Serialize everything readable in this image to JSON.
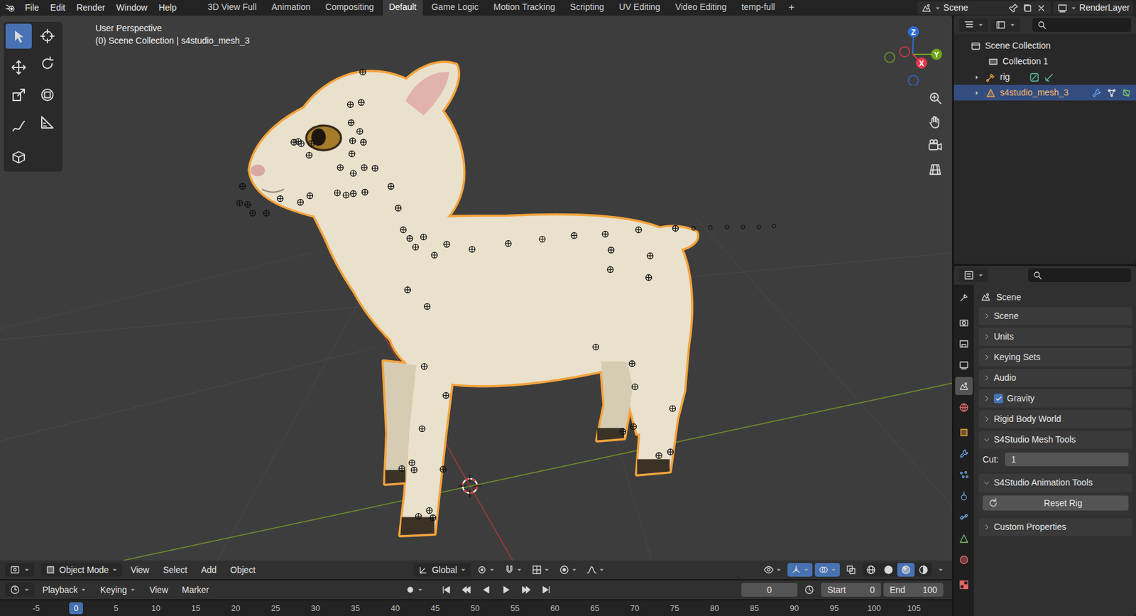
{
  "menu": [
    "File",
    "Edit",
    "Render",
    "Window",
    "Help"
  ],
  "workspaces": [
    {
      "label": "3D View Full",
      "selected": false
    },
    {
      "label": "Animation",
      "selected": false
    },
    {
      "label": "Compositing",
      "selected": false
    },
    {
      "label": "Default",
      "selected": true
    },
    {
      "label": "Game Logic",
      "selected": false
    },
    {
      "label": "Motion Tracking",
      "selected": false
    },
    {
      "label": "Scripting",
      "selected": false
    },
    {
      "label": "UV Editing",
      "selected": false
    },
    {
      "label": "Video Editing",
      "selected": false
    },
    {
      "label": "temp-full",
      "selected": false
    }
  ],
  "add_workspace": "+",
  "scene": {
    "label": "Scene"
  },
  "view_layer": {
    "label": "RenderLayer"
  },
  "viewport": {
    "title": "User Perspective",
    "context": "(0) Scene Collection | s4studio_mesh_3",
    "axes": [
      {
        "label": "Z",
        "color": "#2f6fd6"
      },
      {
        "label": "Y",
        "color": "#6ea51c"
      },
      {
        "label": "X",
        "color": "#e8384e"
      }
    ],
    "tools": [
      {
        "kind": "select-box",
        "selected": true
      },
      {
        "kind": "cursor",
        "selected": false
      },
      {
        "kind": "move",
        "selected": false
      },
      {
        "kind": "rotate",
        "selected": false
      },
      {
        "kind": "scale",
        "selected": false
      },
      {
        "kind": "transform",
        "selected": false
      },
      {
        "kind": "annotate",
        "selected": false
      },
      {
        "kind": "measure",
        "selected": false
      },
      {
        "kind": "add-cube",
        "selected": false
      }
    ],
    "nav": [
      {
        "kind": "zoom"
      },
      {
        "kind": "pan"
      },
      {
        "kind": "camera"
      },
      {
        "kind": "ortho"
      }
    ]
  },
  "viewport_header": {
    "mode": "Object Mode",
    "menus": [
      "View",
      "Select",
      "Add",
      "Object"
    ],
    "orientation": "Global",
    "toggles": [
      {
        "kind": "gizmos",
        "on": true
      },
      {
        "kind": "overlays",
        "on": true
      },
      {
        "kind": "xray",
        "on": false
      }
    ],
    "shading": [
      {
        "kind": "wireframe",
        "selected": false
      },
      {
        "kind": "solid",
        "selected": false
      },
      {
        "kind": "material-shade",
        "selected": true
      },
      {
        "kind": "rendered",
        "selected": false
      }
    ]
  },
  "timeline": {
    "menus": [
      "Playback",
      "Keying",
      "View",
      "Marker"
    ],
    "controls": [
      {
        "kind": "record"
      },
      {
        "kind": "jump-start"
      },
      {
        "kind": "prev-key"
      },
      {
        "kind": "play-reverse"
      },
      {
        "kind": "play"
      },
      {
        "kind": "next-key"
      },
      {
        "kind": "jump-end"
      }
    ],
    "current_frame": "0",
    "start_label": "Start",
    "start": "0",
    "end_label": "End",
    "end": "100",
    "ticks": [
      {
        "label": "-5",
        "selected": false
      },
      {
        "label": "0",
        "selected": true
      },
      {
        "label": "5",
        "selected": false
      },
      {
        "label": "10",
        "selected": false
      },
      {
        "label": "15",
        "selected": false
      },
      {
        "label": "20",
        "selected": false
      },
      {
        "label": "25",
        "selected": false
      },
      {
        "label": "30",
        "selected": false
      },
      {
        "label": "35",
        "selected": false
      },
      {
        "label": "40",
        "selected": false
      },
      {
        "label": "45",
        "selected": false
      },
      {
        "label": "50",
        "selected": false
      },
      {
        "label": "55",
        "selected": false
      },
      {
        "label": "60",
        "selected": false
      },
      {
        "label": "65",
        "selected": false
      },
      {
        "label": "70",
        "selected": false
      },
      {
        "label": "75",
        "selected": false
      },
      {
        "label": "80",
        "selected": false
      },
      {
        "label": "85",
        "selected": false
      },
      {
        "label": "90",
        "selected": false
      },
      {
        "label": "95",
        "selected": false
      },
      {
        "label": "100",
        "selected": false
      },
      {
        "label": "105",
        "selected": false
      }
    ]
  },
  "outliner": {
    "items": [
      {
        "label": "Scene Collection",
        "kind": "scene-collection",
        "selected": false
      },
      {
        "label": "Collection 1",
        "kind": "collection",
        "selected": false
      },
      {
        "label": "rig",
        "kind": "armature",
        "selected": false,
        "expanded": false
      },
      {
        "label": "s4studio_mesh_3",
        "kind": "mesh",
        "selected": true,
        "expanded": false
      }
    ]
  },
  "properties": {
    "title": "Scene",
    "tabs": [
      {
        "kind": "tool",
        "selected": false
      },
      {
        "kind": "render",
        "selected": false
      },
      {
        "kind": "output",
        "selected": false
      },
      {
        "kind": "view-layer",
        "selected": false
      },
      {
        "kind": "scene",
        "selected": true
      },
      {
        "kind": "world",
        "selected": false
      },
      {
        "kind": "object",
        "selected": false
      },
      {
        "kind": "modifiers",
        "selected": false
      },
      {
        "kind": "particles",
        "selected": false
      },
      {
        "kind": "physics",
        "selected": false
      },
      {
        "kind": "constraints",
        "selected": false
      },
      {
        "kind": "data",
        "selected": false
      },
      {
        "kind": "material",
        "selected": false
      },
      {
        "kind": "texture",
        "selected": false
      }
    ],
    "panels": [
      {
        "label": "Scene",
        "kind": "plain",
        "expanded": false
      },
      {
        "label": "Units",
        "kind": "plain",
        "expanded": false
      },
      {
        "label": "Keying Sets",
        "kind": "plain",
        "expanded": false
      },
      {
        "label": "Audio",
        "kind": "plain",
        "expanded": false
      },
      {
        "label": "Gravity",
        "kind": "checkbox",
        "expanded": false,
        "checked": true
      },
      {
        "label": "Rigid Body World",
        "kind": "plain",
        "expanded": false
      },
      {
        "label": "S4Studio Mesh Tools",
        "kind": "field",
        "expanded": true,
        "field_label": "Cut:",
        "field_value": "1"
      },
      {
        "label": "S4Studio Animation Tools",
        "kind": "button",
        "expanded": true,
        "button": "Reset Rig"
      },
      {
        "label": "Custom Properties",
        "kind": "plain",
        "expanded": false
      }
    ]
  }
}
